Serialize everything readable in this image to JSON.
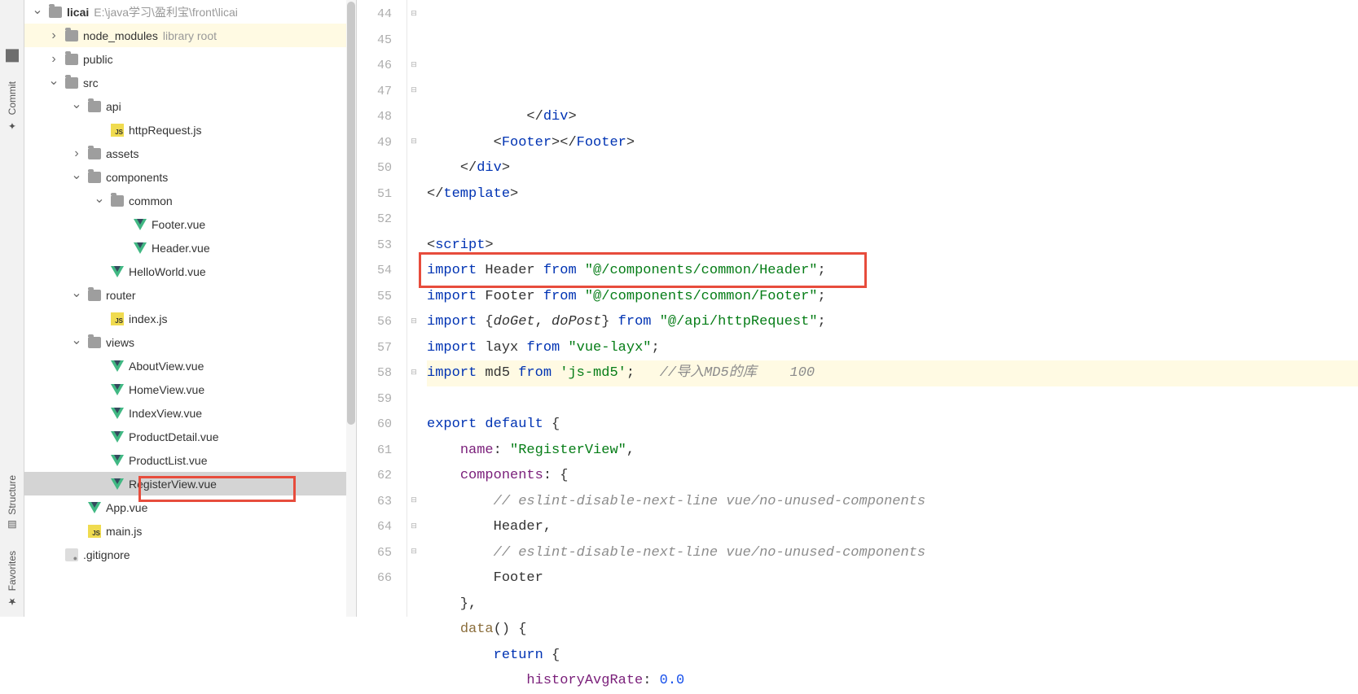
{
  "tool_strip": {
    "project": "Project",
    "commit": "Commit",
    "structure": "Structure",
    "favorites": "Favorites"
  },
  "tree": {
    "root_name": "licai",
    "root_path": "E:\\java学习\\盈利宝\\front\\licai",
    "node_modules": "node_modules",
    "node_modules_hint": "library root",
    "public": "public",
    "src": "src",
    "api": "api",
    "httpRequest": "httpRequest.js",
    "assets": "assets",
    "components": "components",
    "common": "common",
    "footer_vue": "Footer.vue",
    "header_vue": "Header.vue",
    "helloworld": "HelloWorld.vue",
    "router": "router",
    "index_js": "index.js",
    "views": "views",
    "about_view": "AboutView.vue",
    "home_view": "HomeView.vue",
    "index_view": "IndexView.vue",
    "product_detail": "ProductDetail.vue",
    "product_list": "ProductList.vue",
    "register_view": "RegisterView.vue",
    "app_vue": "App.vue",
    "main_js": "main.js",
    "gitignore": ".gitignore"
  },
  "editor": {
    "line_start": 44,
    "lines": {
      "44": {
        "indent": "      ",
        "tokens": [
          {
            "t": "tag-brace",
            "v": "</"
          },
          {
            "t": "tag",
            "v": "div"
          },
          {
            "t": "tag-brace",
            "v": ">"
          }
        ]
      },
      "45": {
        "indent": "    ",
        "tokens": [
          {
            "t": "tag-brace",
            "v": "<"
          },
          {
            "t": "tag",
            "v": "Footer"
          },
          {
            "t": "tag-brace",
            "v": "></"
          },
          {
            "t": "tag",
            "v": "Footer"
          },
          {
            "t": "tag-brace",
            "v": ">"
          }
        ]
      },
      "46": {
        "indent": "  ",
        "tokens": [
          {
            "t": "tag-brace",
            "v": "</"
          },
          {
            "t": "tag",
            "v": "div"
          },
          {
            "t": "tag-brace",
            "v": ">"
          }
        ]
      },
      "47": {
        "indent": "",
        "tokens": [
          {
            "t": "tag-brace",
            "v": "</"
          },
          {
            "t": "tag",
            "v": "template"
          },
          {
            "t": "tag-brace",
            "v": ">"
          }
        ]
      },
      "48": {
        "indent": "",
        "tokens": []
      },
      "49": {
        "indent": "",
        "tokens": [
          {
            "t": "tag-brace",
            "v": "<"
          },
          {
            "t": "tag",
            "v": "script"
          },
          {
            "t": "tag-brace",
            "v": ">"
          }
        ]
      },
      "50": {
        "indent": "",
        "tokens": [
          {
            "t": "import-kw",
            "v": "import "
          },
          {
            "t": "plain",
            "v": "Header "
          },
          {
            "t": "import-kw",
            "v": "from "
          },
          {
            "t": "str",
            "v": "\"@/components/common/Header\""
          },
          {
            "t": "plain",
            "v": ";"
          }
        ]
      },
      "51": {
        "indent": "",
        "tokens": [
          {
            "t": "import-kw",
            "v": "import "
          },
          {
            "t": "plain",
            "v": "Footer "
          },
          {
            "t": "import-kw",
            "v": "from "
          },
          {
            "t": "str",
            "v": "\"@/components/common/Footer\""
          },
          {
            "t": "plain",
            "v": ";"
          }
        ]
      },
      "52": {
        "indent": "",
        "tokens": [
          {
            "t": "import-kw",
            "v": "import "
          },
          {
            "t": "plain",
            "v": "{"
          },
          {
            "t": "ident",
            "v": "doGet"
          },
          {
            "t": "plain",
            "v": ", "
          },
          {
            "t": "ident",
            "v": "doPost"
          },
          {
            "t": "plain",
            "v": "} "
          },
          {
            "t": "import-kw",
            "v": "from "
          },
          {
            "t": "str",
            "v": "\"@/api/httpRequest\""
          },
          {
            "t": "plain",
            "v": ";"
          }
        ]
      },
      "53": {
        "indent": "",
        "tokens": [
          {
            "t": "import-kw",
            "v": "import "
          },
          {
            "t": "plain",
            "v": "layx "
          },
          {
            "t": "import-kw",
            "v": "from "
          },
          {
            "t": "str",
            "v": "\"vue-layx\""
          },
          {
            "t": "plain",
            "v": ";"
          }
        ]
      },
      "54": {
        "indent": "",
        "current": true,
        "tokens": [
          {
            "t": "import-kw",
            "v": "import "
          },
          {
            "t": "plain",
            "v": "md5 "
          },
          {
            "t": "import-kw",
            "v": "from "
          },
          {
            "t": "str2",
            "v": "'js-md5'"
          },
          {
            "t": "plain",
            "v": ";   "
          },
          {
            "t": "comment",
            "v": "//导入MD5的库    100"
          }
        ]
      },
      "55": {
        "indent": "",
        "tokens": []
      },
      "56": {
        "indent": "",
        "tokens": [
          {
            "t": "import-kw",
            "v": "export default "
          },
          {
            "t": "plain",
            "v": "{"
          }
        ]
      },
      "57": {
        "indent": "  ",
        "tokens": [
          {
            "t": "prop",
            "v": "name"
          },
          {
            "t": "plain",
            "v": ": "
          },
          {
            "t": "str",
            "v": "\"RegisterView\""
          },
          {
            "t": "plain",
            "v": ","
          }
        ]
      },
      "58": {
        "indent": "  ",
        "tokens": [
          {
            "t": "prop",
            "v": "components"
          },
          {
            "t": "plain",
            "v": ": {"
          }
        ]
      },
      "59": {
        "indent": "    ",
        "tokens": [
          {
            "t": "comment",
            "v": "// eslint-disable-next-line vue/no-unused-components"
          }
        ]
      },
      "60": {
        "indent": "    ",
        "tokens": [
          {
            "t": "plain",
            "v": "Header,"
          }
        ]
      },
      "61": {
        "indent": "    ",
        "tokens": [
          {
            "t": "comment",
            "v": "// eslint-disable-next-line vue/no-unused-components"
          }
        ]
      },
      "62": {
        "indent": "    ",
        "tokens": [
          {
            "t": "plain",
            "v": "Footer"
          }
        ]
      },
      "63": {
        "indent": "  ",
        "tokens": [
          {
            "t": "plain",
            "v": "},"
          }
        ]
      },
      "64": {
        "indent": "  ",
        "tokens": [
          {
            "t": "method",
            "v": "data"
          },
          {
            "t": "plain",
            "v": "() {"
          }
        ]
      },
      "65": {
        "indent": "    ",
        "tokens": [
          {
            "t": "import-kw",
            "v": "return "
          },
          {
            "t": "plain",
            "v": "{"
          }
        ]
      },
      "66": {
        "indent": "      ",
        "tokens": [
          {
            "t": "prop",
            "v": "historyAvgRate"
          },
          {
            "t": "plain",
            "v": ": "
          },
          {
            "t": "num",
            "v": "0.0"
          }
        ]
      }
    },
    "fold_marks": {
      "44": "close",
      "45": "",
      "46": "close",
      "47": "close",
      "49": "open",
      "54": "",
      "56": "open",
      "58": "open",
      "63": "close",
      "64": "open",
      "65": "open"
    }
  }
}
